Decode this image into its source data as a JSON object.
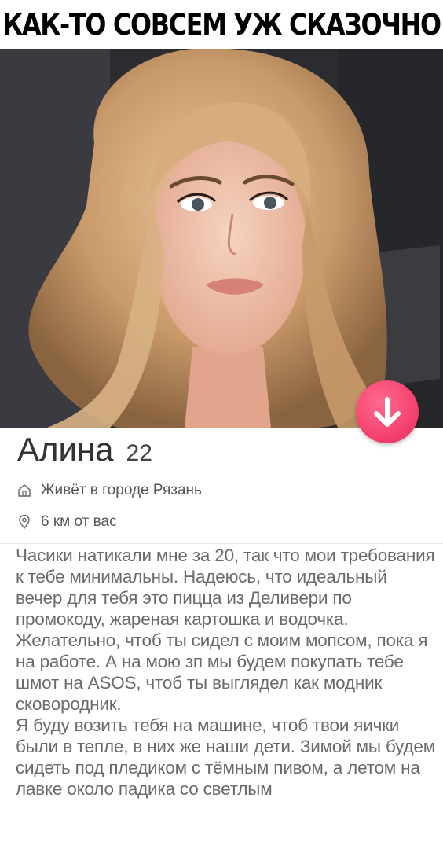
{
  "meme": {
    "title": "КАК-ТО СОВСЕМ УЖ СКАЗОЧНО"
  },
  "profile": {
    "name": "Алина",
    "age": "22",
    "city": "Живёт в городе Рязань",
    "distance": "6 км от вас",
    "photo_icon": "profile-photo",
    "home_icon": "home-icon",
    "location_icon": "location-pin-icon",
    "dislike_icon": "arrow-down-icon",
    "accent_color": "#f23d6a"
  },
  "bio": {
    "paragraphs": [
      "Часики натикали мне за 20, так что мои требования к тебе минимальны. Надеюсь, что идеальный вечер для тебя это пицца из Деливери по промокоду, жареная картошка и водочка.",
      "Желательно, чтоб ты сидел с моим мопсом, пока я на работе. А на мою зп мы будем покупать тебе шмот на ASOS, чтоб ты выглядел как модник сковородник.",
      "Я буду возить тебя на машине, чтоб твои яички были в тепле, в них же наши дети. Зимой мы будем сидеть под пледиком с тёмным пивом, а летом на лавке около падика со светлым"
    ]
  }
}
